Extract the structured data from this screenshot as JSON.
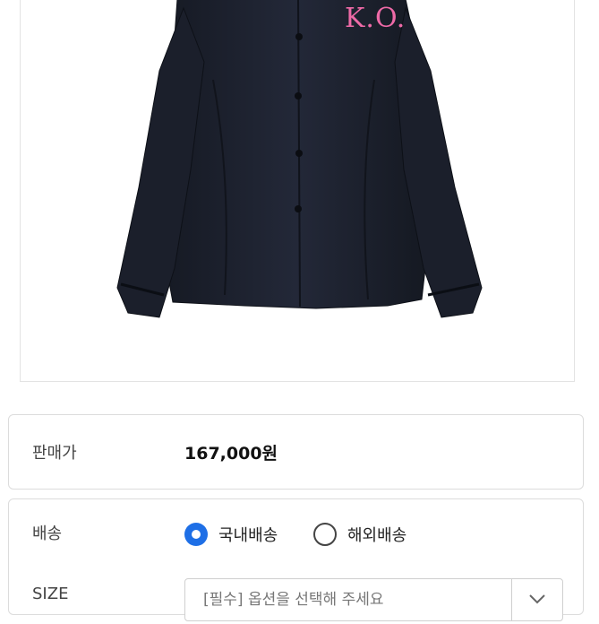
{
  "product": {
    "image_name": "black-shirt-image",
    "logo_text": "K.O."
  },
  "price": {
    "label": "판매가",
    "value": "167,000원"
  },
  "shipping": {
    "label": "배송",
    "options": [
      {
        "label": "국내배송",
        "selected": true
      },
      {
        "label": "해외배송",
        "selected": false
      }
    ]
  },
  "size": {
    "label": "SIZE",
    "placeholder": "[필수] 옵션을 선택해 주세요"
  },
  "colors": {
    "accent": "#1e6fe6",
    "shirt": "#1f2330",
    "logo": "#ee6aa7"
  },
  "icons": {
    "dropdown": "chevron-down-icon"
  }
}
